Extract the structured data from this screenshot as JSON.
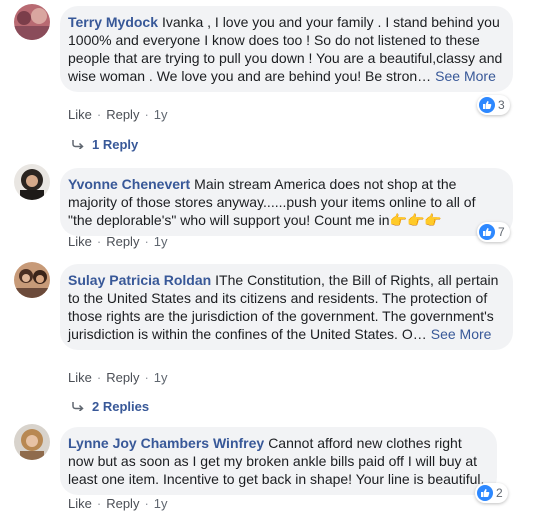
{
  "comments": [
    {
      "author": "Terry Mydock",
      "text": "Ivanka , I love you and your family . I stand behind you 1000% and everyone I know does too ! So do not listened to these people that are trying to pull you down ! You are a beautiful,classy and wise woman . We love you and are behind you! Be stron…",
      "see_more": "See More",
      "like": "Like",
      "reply": "Reply",
      "time": "1y",
      "reaction_count": "3",
      "replies": "1 Reply"
    },
    {
      "author": "Yvonne Chenevert",
      "text": "Main stream America does not shop at the majority of those stores anyway......push your items online to all of \"the deplorable's\" who will support you! Count me in",
      "emoji": "👉👉👉",
      "like": "Like",
      "reply": "Reply",
      "time": "1y",
      "reaction_count": "7"
    },
    {
      "author": "Sulay Patricia Roldan",
      "text": "IThe Constitution, the Bill of Rights, all pertain to the United States and its citizens and residents. The protection of those rights are the jurisdiction of the government. The government's jurisdiction is within the confines of the United States. O…",
      "see_more": "See More",
      "like": "Like",
      "reply": "Reply",
      "time": "1y",
      "replies": "2 Replies"
    },
    {
      "author": "Lynne Joy Chambers Winfrey",
      "text": "Cannot afford new clothes right now but as soon as I get my broken ankle bills paid off I will buy at least one item. Incentive to get back in shape! Your line is beautiful.",
      "like": "Like",
      "reply": "Reply",
      "time": "1y",
      "reaction_count": "2"
    }
  ],
  "colors": {
    "link": "#385898",
    "bubble": "#f2f3f5",
    "like_blue": "#2d88ff"
  }
}
